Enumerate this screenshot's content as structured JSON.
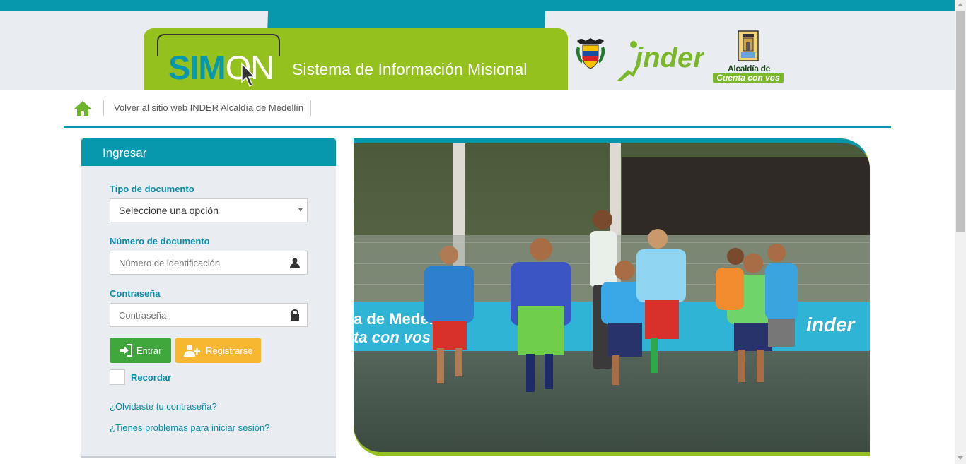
{
  "header": {
    "logo_part1": "SIM",
    "logo_part2": "ON",
    "system_title": "Sistema de Información Misional",
    "inder_logo": "inder",
    "alcaldia_line1": "Alcaldía de Medellín",
    "alcaldia_line2": "Cuenta con vos"
  },
  "nav": {
    "home_icon": "home-icon",
    "link_label": "Volver al sitio web INDER Alcaldía de Medellín"
  },
  "login": {
    "title": "Ingresar",
    "doc_type_label": "Tipo de documento",
    "doc_type_selected": "Seleccione una opción",
    "doc_number_label": "Número de documento",
    "doc_number_placeholder": "Número de identificación",
    "password_label": "Contraseña",
    "password_placeholder": "Contraseña",
    "enter_button": "Entrar",
    "register_button": "Registrarse",
    "remember_label": "Recordar",
    "forgot_link": "¿Olvidaste tu contraseña?",
    "problems_link": "¿Tienes problemas para iniciar sesión?"
  },
  "banner": {
    "wall_text1": "a de Medellín",
    "wall_text2": "ta con vos",
    "wall_logo": "inder"
  },
  "colors": {
    "primary_teal": "#0898ad",
    "brand_green": "#95c11f",
    "enter_green": "#3ea63b",
    "register_yellow": "#f7b731"
  }
}
